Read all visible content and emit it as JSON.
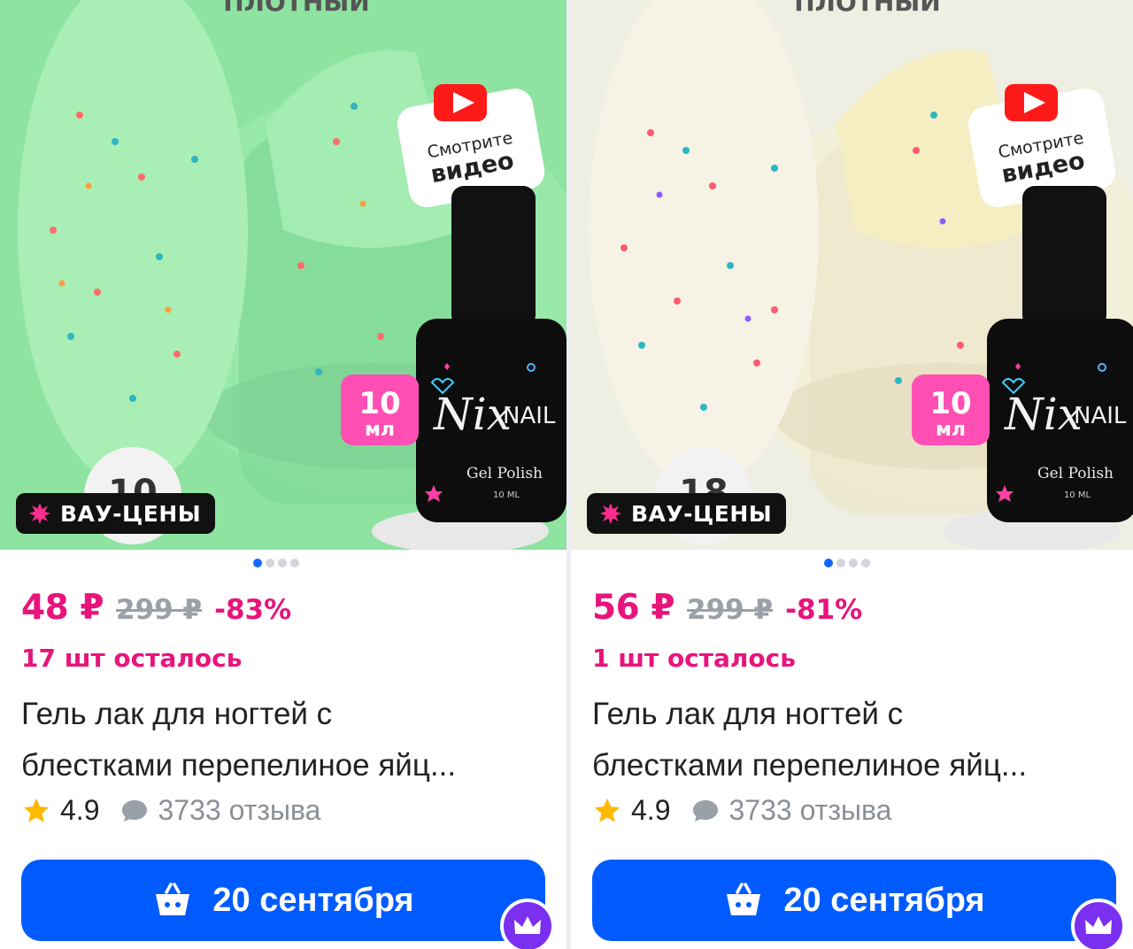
{
  "products": [
    {
      "photo": {
        "top_label": "ПЛОТНЫЙ",
        "video_label_1": "Смотрите",
        "video_label_2": "видео",
        "volume_num": "10",
        "volume_unit": "мл",
        "shade_number": "10",
        "brand_script": "Nix",
        "brand": "NAIL",
        "bottle_label": "Gel Polish",
        "bottle_ml": "10 ML",
        "bg_color": "#8ee3a0",
        "nail_color": "#a9eeb4"
      },
      "promo_badge": "ВАУ-ЦЕНЫ",
      "price": "48 ₽",
      "old_price": "299 ₽",
      "discount": "-83%",
      "stock_left": "17 шт осталось",
      "title_line1": "Гель лак для ногтей с",
      "title_line2": "блестками перепелиное яйц...",
      "rating": "4.9",
      "reviews": "3733 отзыва",
      "delivery_button": "20 сентября"
    },
    {
      "photo": {
        "top_label": "ПЛОТНЫЙ",
        "video_label_1": "Смотрите",
        "video_label_2": "видео",
        "volume_num": "10",
        "volume_unit": "мл",
        "shade_number": "18",
        "brand_script": "Nix",
        "brand": "NAIL",
        "bottle_label": "Gel Polish",
        "bottle_ml": "10 ML",
        "bg_color": "#eeeee2",
        "nail_color": "#f6f3e6"
      },
      "promo_badge": "ВАУ-ЦЕНЫ",
      "price": "56 ₽",
      "old_price": "299 ₽",
      "discount": "-81%",
      "stock_left": "1 шт осталось",
      "title_line1": "Гель лак для ногтей с",
      "title_line2": "блестками перепелиное яйц...",
      "rating": "4.9",
      "reviews": "3733 отзыва",
      "delivery_button": "20 сентября"
    }
  ],
  "colors": {
    "accent_pink": "#e8147c",
    "button_blue": "#005bff",
    "muted_gray": "#8a8f98",
    "star_yellow": "#ffb800"
  },
  "icons": [
    "video-play-icon",
    "burst-icon",
    "star-icon",
    "comment-bubble-icon",
    "cart-icon",
    "crown-icon"
  ]
}
